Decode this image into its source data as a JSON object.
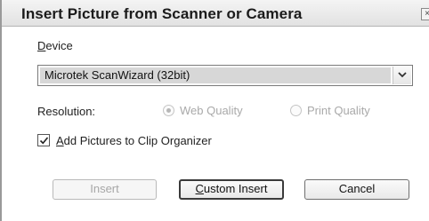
{
  "dialog": {
    "title": "Insert Picture from Scanner or Camera",
    "close_glyph": "×"
  },
  "device": {
    "label_accel": "D",
    "label_rest": "evice",
    "selected": "Microtek ScanWizard (32bit)"
  },
  "resolution": {
    "label": "Resolution:",
    "options": [
      {
        "label": "Web Quality",
        "checked": true,
        "enabled": false
      },
      {
        "label": "Print Quality",
        "checked": false,
        "enabled": false
      }
    ]
  },
  "clip_organizer": {
    "label_accel": "A",
    "label_rest": "dd Pictures to Clip Organizer",
    "checked": true
  },
  "buttons": {
    "insert": "Insert",
    "custom_insert_accel": "C",
    "custom_insert_rest": "ustom Insert",
    "cancel": "Cancel"
  }
}
